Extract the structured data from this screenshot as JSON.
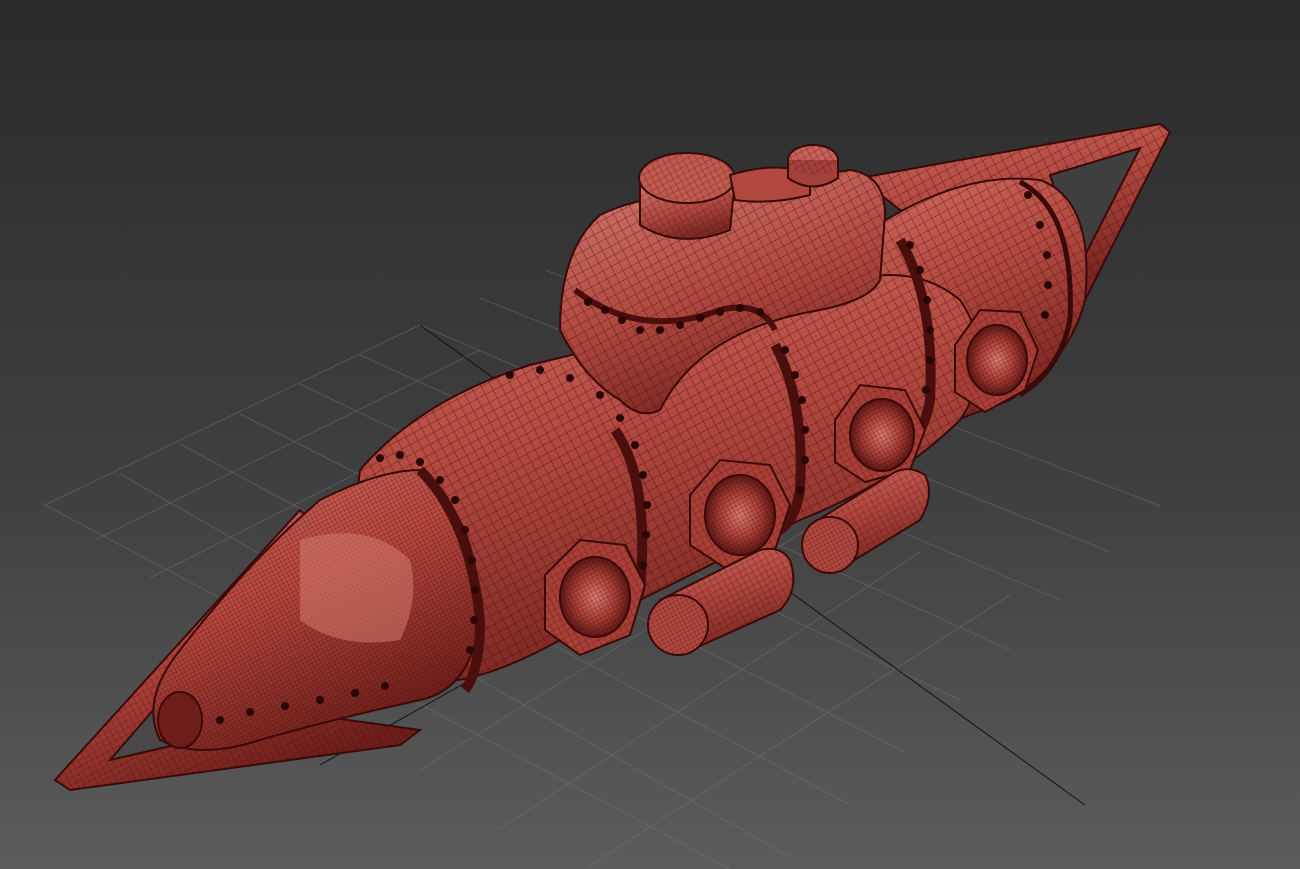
{
  "viewport": {
    "background_top": "#2c2c2c",
    "background_bottom": "#5a5a5a",
    "grid_color": "#6f6f6f",
    "axis_color": "#111111",
    "shading_mode": "wireframe-on-shaded"
  },
  "model": {
    "object": "submarine",
    "base_color": "#b8453d",
    "highlight_color": "#d9736a",
    "shadow_color": "#6e1e1a",
    "wire_color": "#3a0a08",
    "rivet_color": "#2a0605",
    "porthole_count": 4,
    "tank_count": 2
  }
}
